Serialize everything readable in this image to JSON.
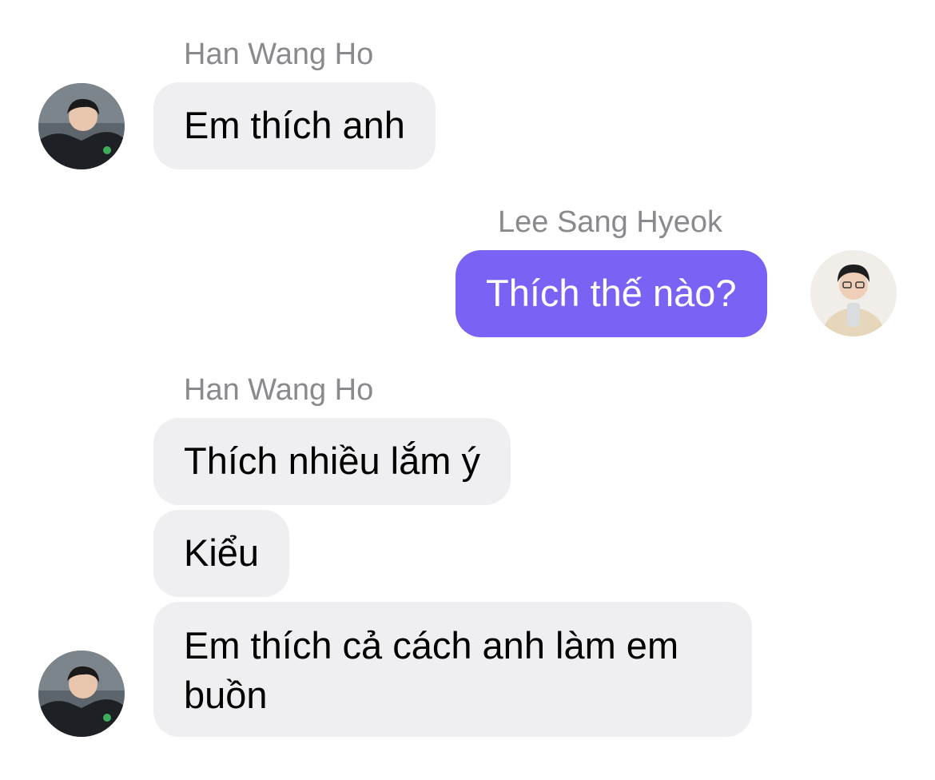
{
  "conversation": {
    "messages": [
      {
        "sender": "Han Wang Ho",
        "text": "Em thích anh"
      },
      {
        "sender": "Lee Sang Hyeok",
        "text": "Thích thế nào?"
      },
      {
        "sender": "Han Wang Ho",
        "text": "Thích nhiều lắm ý"
      },
      {
        "sender": "Han Wang Ho",
        "text": "Kiểu"
      },
      {
        "sender": "Han Wang Ho",
        "text": "Em thích cả cách anh làm em buồn"
      }
    ]
  },
  "colors": {
    "outgoing_bubble": "#7a62f4",
    "incoming_bubble": "#efeff2",
    "sender_name": "#8a8a8e"
  }
}
